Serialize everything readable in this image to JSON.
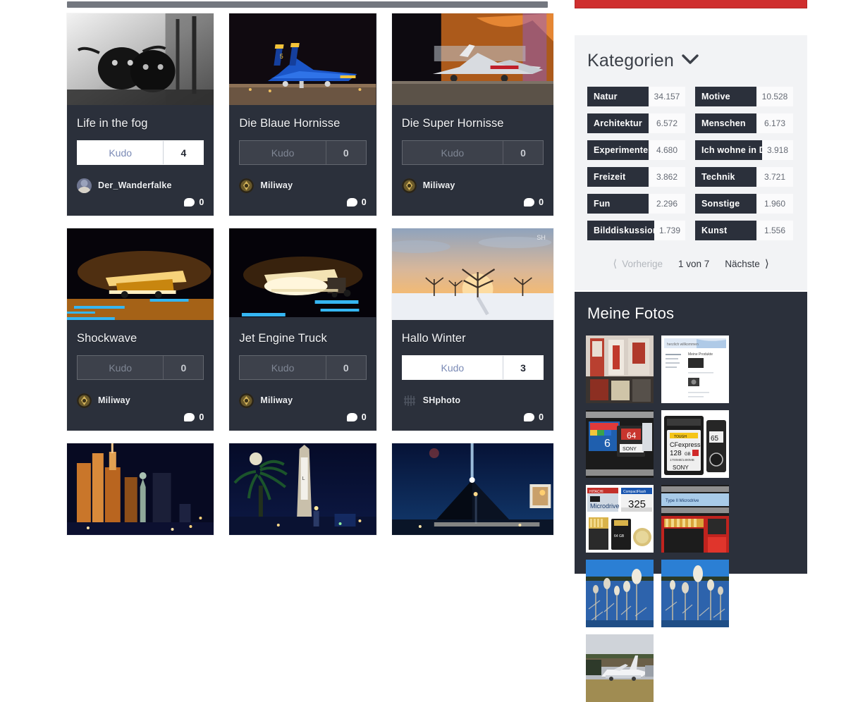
{
  "colors": {
    "card_bg": "#2b303b",
    "panel_bg": "#f2f3f5",
    "accent_red": "#cf2e2e",
    "kudo_link": "#7a8ab5",
    "page_bg": "#ffffff"
  },
  "main": {
    "photo_cards": [
      {
        "title": "Life in the fog",
        "kudo_label": "Kudo",
        "kudo_count": "4",
        "kudo_enabled": true,
        "author": "Der_Wanderfalke",
        "avatar": "user-photo-avatar",
        "comment_count": "0",
        "image": "highland-cattle-bw"
      },
      {
        "title": "Die Blaue Hornisse",
        "kudo_label": "Kudo",
        "kudo_count": "0",
        "kudo_enabled": false,
        "author": "Miliway",
        "avatar": "eagle-crest-avatar",
        "comment_count": "0",
        "image": "blue-angels-fa18-night"
      },
      {
        "title": "Die Super Hornisse",
        "kudo_label": "Kudo",
        "kudo_count": "0",
        "kudo_enabled": false,
        "author": "Miliway",
        "avatar": "eagle-crest-avatar",
        "comment_count": "0",
        "image": "super-hornet-afterburner"
      },
      {
        "title": "Shockwave",
        "kudo_label": "Kudo",
        "kudo_count": "0",
        "kudo_enabled": false,
        "author": "Miliway",
        "avatar": "eagle-crest-avatar",
        "comment_count": "0",
        "image": "jet-truck-shockwave"
      },
      {
        "title": "Jet Engine Truck",
        "kudo_label": "Kudo",
        "kudo_count": "0",
        "kudo_enabled": false,
        "author": "Miliway",
        "avatar": "eagle-crest-avatar",
        "comment_count": "0",
        "image": "jet-engine-truck"
      },
      {
        "title": "Hallo Winter",
        "kudo_label": "Kudo",
        "kudo_count": "3",
        "kudo_enabled": true,
        "author": "SHphoto",
        "avatar": "sh-monogram-avatar",
        "comment_count": "0",
        "image": "winter-sunset-trees"
      }
    ],
    "bottom_row_images": [
      "las-vegas-new-york-new-york",
      "las-vegas-luxor-obelisk",
      "las-vegas-luxor-pyramid"
    ]
  },
  "sidebar": {
    "categories_panel": {
      "title": "Kategorien",
      "toggle_icon": "chevron-down-icon",
      "items": [
        {
          "name": "Natur",
          "count": "34.157"
        },
        {
          "name": "Motive",
          "count": "10.528"
        },
        {
          "name": "Architektur",
          "count": "6.572"
        },
        {
          "name": "Menschen",
          "count": "6.173"
        },
        {
          "name": "Experimente",
          "count": "4.680"
        },
        {
          "name": "Ich wohne in D",
          "count": "3.918"
        },
        {
          "name": "Freizeit",
          "count": "3.862"
        },
        {
          "name": "Technik",
          "count": "3.721"
        },
        {
          "name": "Fun",
          "count": "2.296"
        },
        {
          "name": "Sonstige",
          "count": "1.960"
        },
        {
          "name": "Bilddiskussion",
          "count": "1.739"
        },
        {
          "name": "Kunst",
          "count": "1.556"
        }
      ],
      "pager": {
        "prev_label": "Vorherige",
        "prev_icon": "chevron-left-icon",
        "current": "1 von 7",
        "next_label": "Nächste",
        "next_icon": "chevron-right-icon",
        "prev_disabled": true
      }
    },
    "my_photos_panel": {
      "title": "Meine Fotos",
      "thumbnails": [
        "workshop-red-machines",
        "mystory-welcome-webpage",
        "memory-cards-stack",
        "sony-cfexpress-128gb",
        "hitachi-microdrive-compactflash",
        "red-memory-card-macro",
        "frost-plants-blue-water-1",
        "frost-plants-blue-water-2",
        "airliner-on-apron"
      ]
    }
  }
}
